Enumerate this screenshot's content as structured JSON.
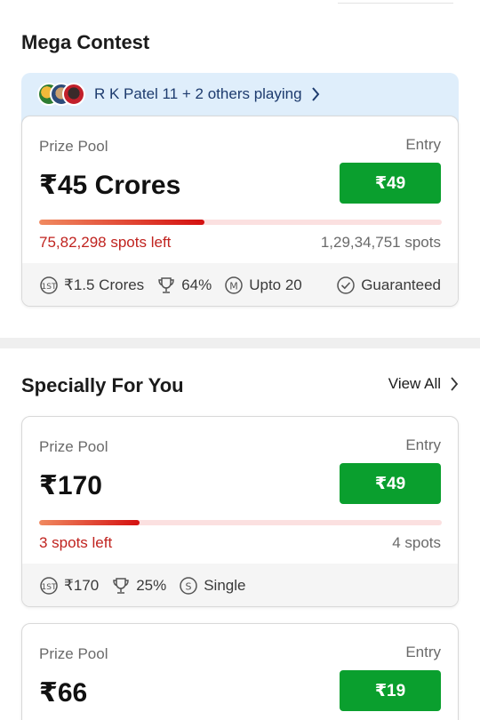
{
  "sections": {
    "mega_title": "Mega Contest",
    "special_title": "Specially For You",
    "view_all": "View All"
  },
  "banner": {
    "text": "R K Patel 11 + 2 others playing"
  },
  "cards": [
    {
      "prize_label": "Prize Pool",
      "prize": "₹45 Crores",
      "entry_label": "Entry",
      "entry_fee": "₹49",
      "progress_fraction": 0.41,
      "spots_left": "75,82,298 spots left",
      "spots_total": "1,29,34,751 spots",
      "first_prize": "₹1.5 Crores",
      "win_percent": "64%",
      "multi_entry": "Upto 20",
      "guaranteed": "Guaranteed"
    },
    {
      "prize_label": "Prize Pool",
      "prize": "₹170",
      "entry_label": "Entry",
      "entry_fee": "₹49",
      "progress_fraction": 0.25,
      "spots_left": "3 spots left",
      "spots_total": "4 spots",
      "first_prize": "₹170",
      "win_percent": "25%",
      "entry_type": "Single"
    },
    {
      "prize_label": "Prize Pool",
      "prize": "₹66",
      "entry_label": "Entry",
      "entry_fee": "₹19"
    }
  ],
  "icons": {
    "first_prize": "first-rank-medal-icon",
    "win_percent": "trophy-icon",
    "multi_entry": "m-badge-icon",
    "single_entry": "s-badge-icon",
    "guaranteed": "check-circle-icon",
    "chevron": "chevron-right-icon"
  },
  "colors": {
    "join_button": "#0a9f2e",
    "spots_left": "#c0231f",
    "banner_bg": "#dfeefb"
  }
}
